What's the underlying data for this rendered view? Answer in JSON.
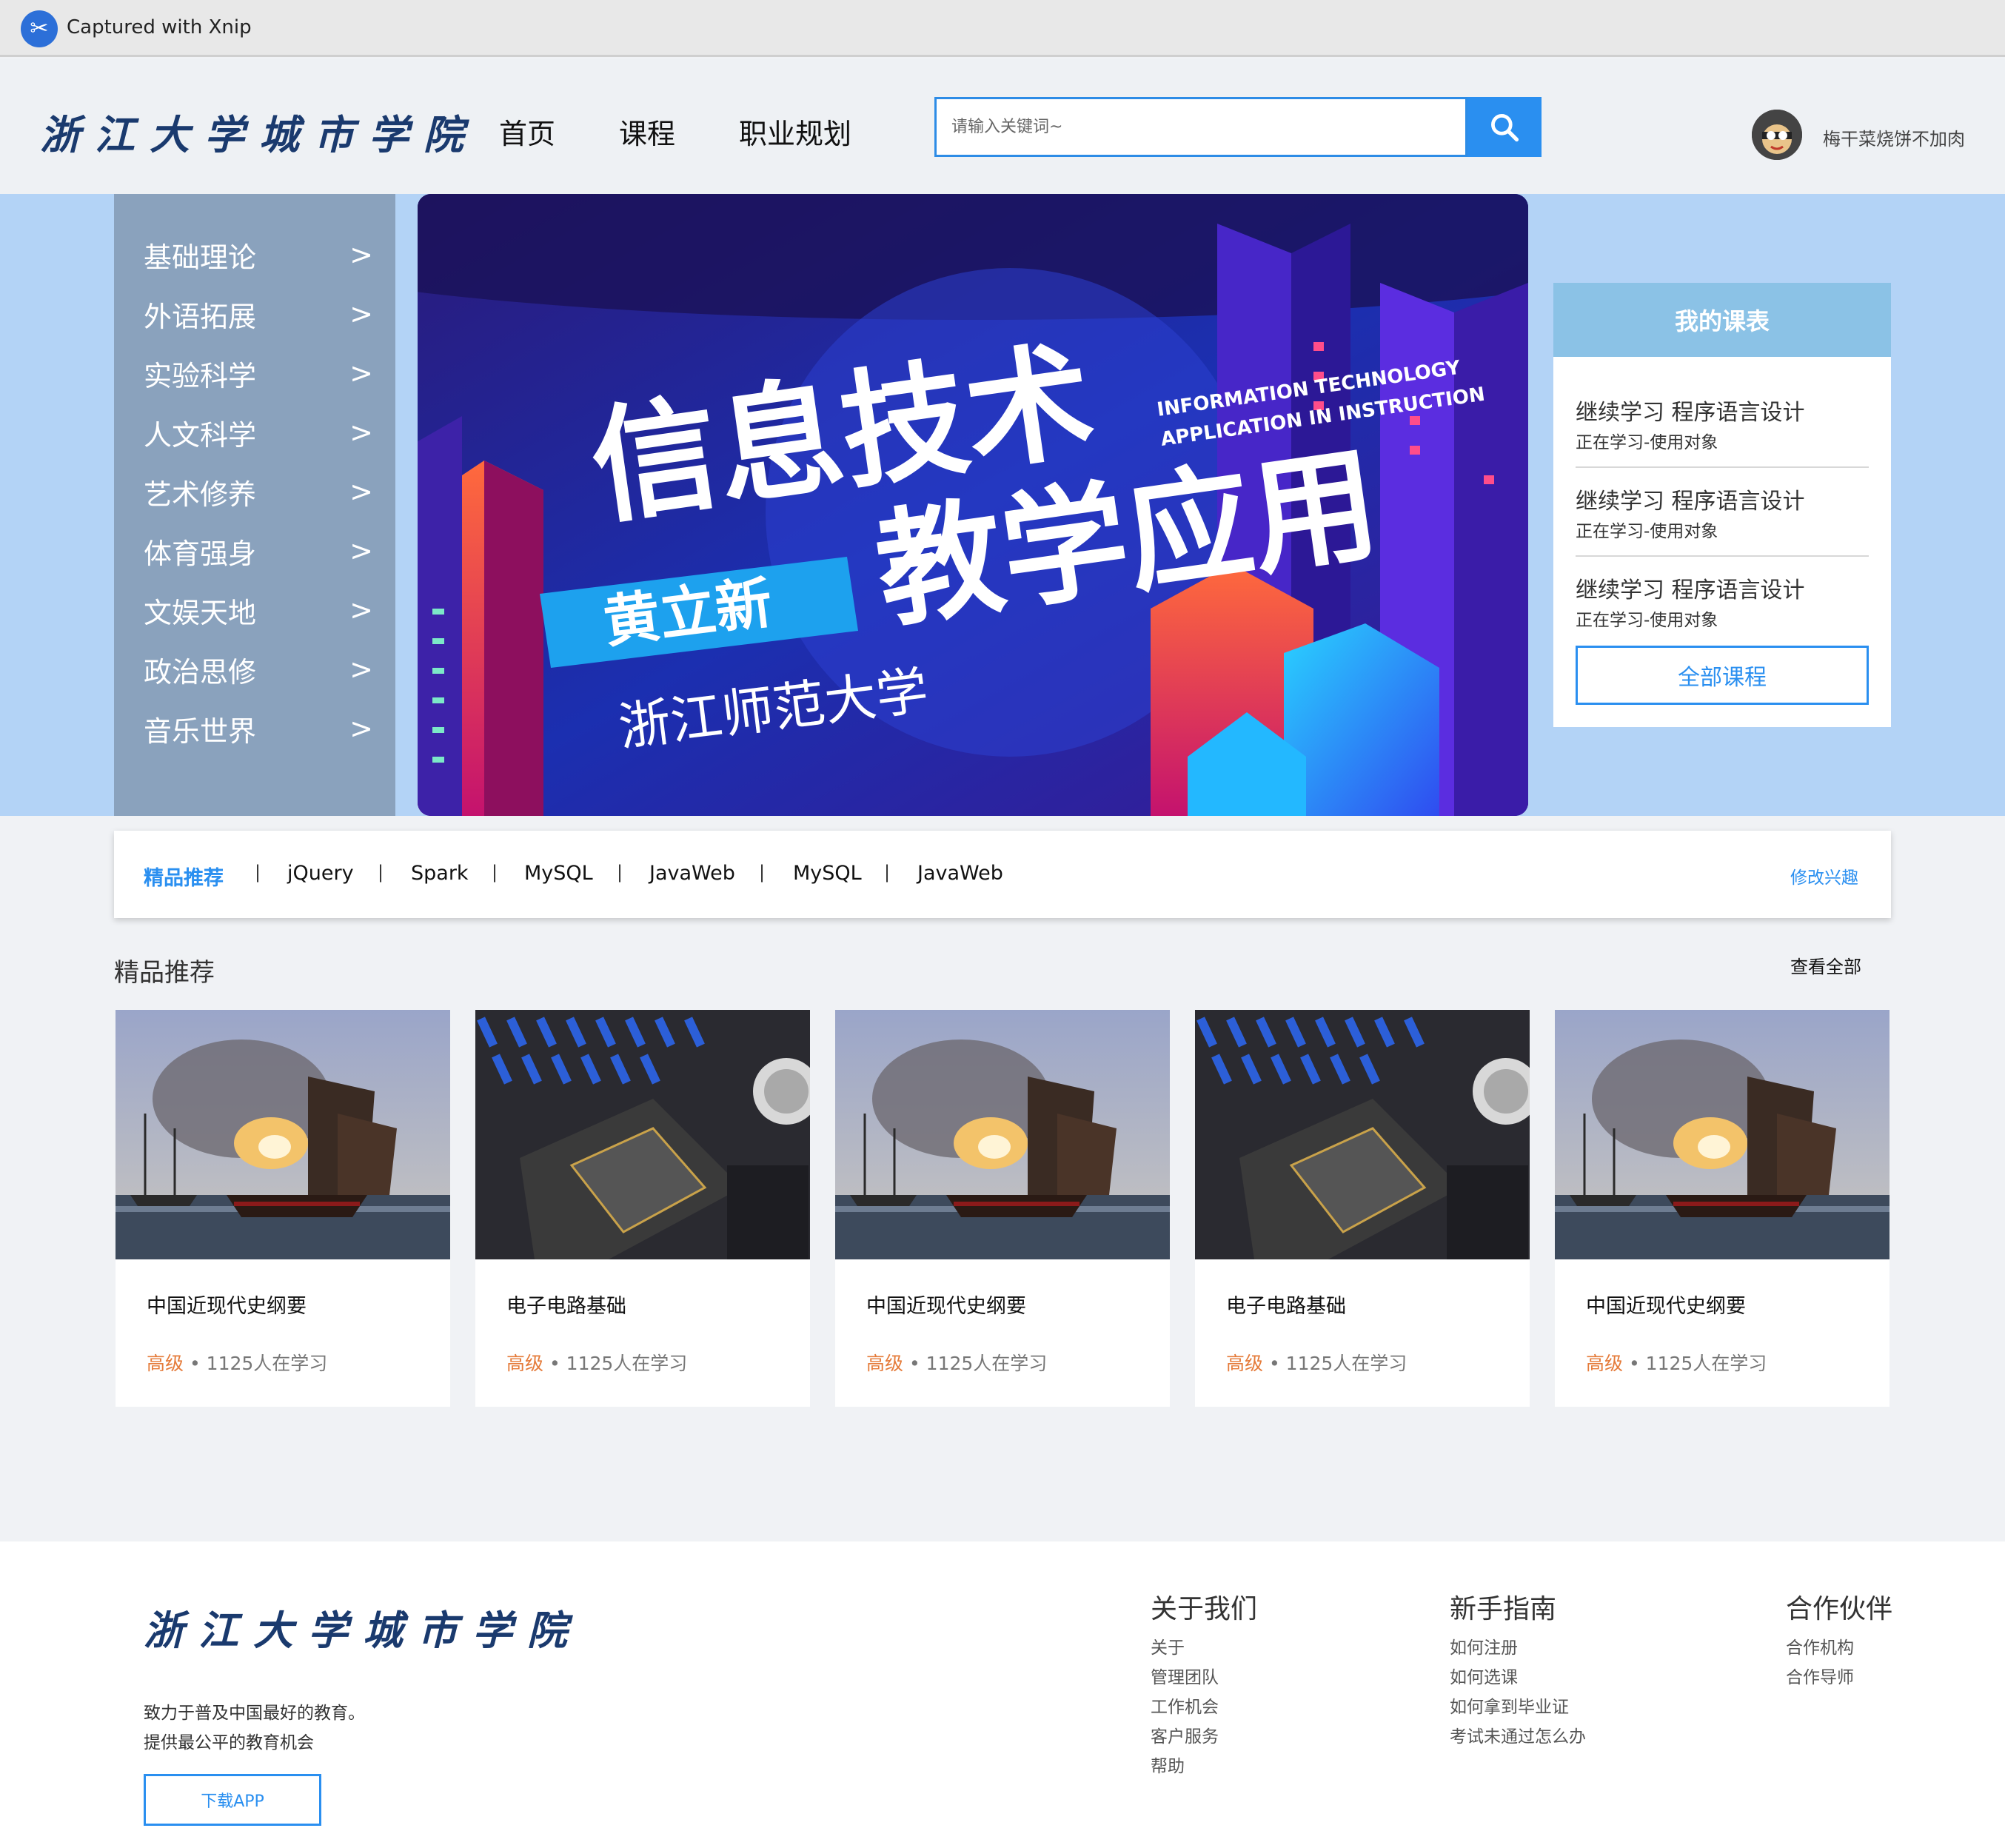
{
  "capture_bar": {
    "label": "Captured with Xnip"
  },
  "header": {
    "logo": "浙江大学城市学院",
    "nav": [
      "首页",
      "课程",
      "职业规划"
    ],
    "search_placeholder": "请输入关键词~",
    "username": "梅干菜烧饼不加肉"
  },
  "sidebar": {
    "items": [
      {
        "label": "基础理论",
        "arrow": ">"
      },
      {
        "label": "外语拓展",
        "arrow": ">"
      },
      {
        "label": "实验科学",
        "arrow": ">"
      },
      {
        "label": "人文科学",
        "arrow": ">"
      },
      {
        "label": "艺术修养",
        "arrow": ">"
      },
      {
        "label": "体育强身",
        "arrow": ">"
      },
      {
        "label": "文娱天地",
        "arrow": ">"
      },
      {
        "label": "政治思修",
        "arrow": ">"
      },
      {
        "label": "音乐世界",
        "arrow": ">"
      }
    ]
  },
  "banner": {
    "title1": "信息技术",
    "title2": "教学应用",
    "en1": "INFORMATION TECHNOLOGY",
    "en2": "APPLICATION IN INSTRUCTION",
    "teacher": "黄立新",
    "school": "浙江师范大学"
  },
  "schedule": {
    "title": "我的课表",
    "items": [
      {
        "title": "继续学习 程序语言设计",
        "sub": "正在学习-使用对象"
      },
      {
        "title": "继续学习 程序语言设计",
        "sub": "正在学习-使用对象"
      },
      {
        "title": "继续学习 程序语言设计",
        "sub": "正在学习-使用对象"
      }
    ],
    "all_button": "全部课程"
  },
  "tabs": {
    "items": [
      "精品推荐",
      "jQuery",
      "Spark",
      "MySQL",
      "JavaWeb",
      "MySQL",
      "JavaWeb"
    ],
    "separator": "|",
    "edit": "修改兴趣"
  },
  "section": {
    "title": "精品推荐",
    "view_all": "查看全部"
  },
  "courses": [
    {
      "title": "中国近现代史纲要",
      "level": "高级",
      "dot": "•",
      "learners": "1125人在学习",
      "image": "history-painting"
    },
    {
      "title": "电子电路基础",
      "level": "高级",
      "dot": "•",
      "learners": "1125人在学习",
      "image": "circuit-board"
    },
    {
      "title": "中国近现代史纲要",
      "level": "高级",
      "dot": "•",
      "learners": "1125人在学习",
      "image": "history-painting"
    },
    {
      "title": "电子电路基础",
      "level": "高级",
      "dot": "•",
      "learners": "1125人在学习",
      "image": "circuit-board"
    },
    {
      "title": "中国近现代史纲要",
      "level": "高级",
      "dot": "•",
      "learners": "1125人在学习",
      "image": "history-painting"
    }
  ],
  "footer": {
    "logo": "浙江大学城市学院",
    "desc1": "致力于普及中国最好的教育。",
    "desc2": "提供最公平的教育机会",
    "download": "下载APP",
    "columns": [
      {
        "title": "关于我们",
        "links": [
          "关于",
          "管理团队",
          "工作机会",
          "客户服务",
          "帮助"
        ]
      },
      {
        "title": "新手指南",
        "links": [
          "如何注册",
          "如何选课",
          "如何拿到毕业证",
          "考试未通过怎么办"
        ]
      },
      {
        "title": "合作伙伴",
        "links": [
          "合作机构",
          "合作导师"
        ]
      }
    ]
  },
  "colors": {
    "accent": "#2a8ff0",
    "hero_bg": "#b3d3f6",
    "sidebar_bg": "#8aa2bd",
    "schedule_head": "#8bc2e6",
    "level": "#e57b3a"
  }
}
